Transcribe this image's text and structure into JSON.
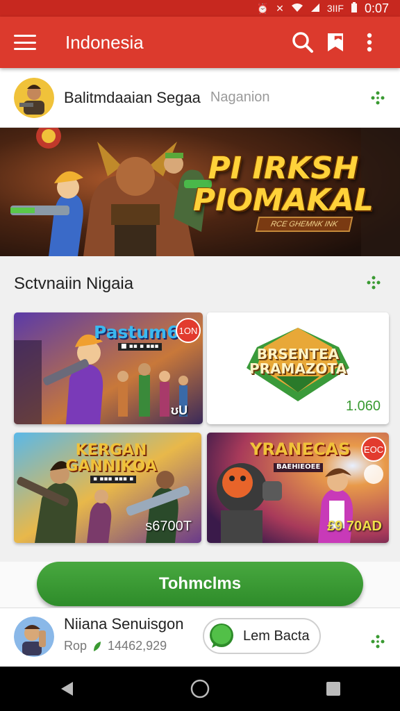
{
  "status_bar": {
    "time": "0:07",
    "icons": [
      "alarm-icon",
      "mute-icon",
      "wifi-icon",
      "signal-icon",
      "battery-icon"
    ],
    "carrier_text": "3IIF"
  },
  "app_bar": {
    "title": "Indonesia",
    "actions": [
      "search-icon",
      "bookmark-icon",
      "more-vert-icon"
    ]
  },
  "profile": {
    "name": "Balitmdaaian Segaa",
    "subtitle": "Naganion"
  },
  "hero_banner": {
    "title_line1": "PI IRKSH",
    "title_line2": "PIOMAKAL",
    "ribbon": "RCE GHEMNK INK"
  },
  "section": {
    "title": "Sctvnaiin Nigaia",
    "cards": [
      {
        "title": "Pastum6",
        "subtitle": "■ ▪▪ ▪ ▪▪▪",
        "badge": "1ON",
        "tag": "ʊU"
      },
      {
        "title_line1": "BRSENTEA",
        "title_line2": "PRAMAZOTA",
        "value": "1.060"
      },
      {
        "title_line1": "KERGAN",
        "title_line2": "GANNIKOA",
        "subtitle": "▪ ▪▪▪ ▪▪▪ ▪",
        "value": "s6700T"
      },
      {
        "title": "YRANECAS",
        "subtitle": "BAEHIEOEE",
        "badge": "EOC",
        "value": "£9 70AD"
      }
    ]
  },
  "cta": {
    "label": "Tohmclms"
  },
  "bottom_item": {
    "name": "Niiana Senuisgon",
    "meta_label": "Rop",
    "meta_value": "14462,929",
    "button_label": "Lem Bacta"
  },
  "nav_bar": {
    "buttons": [
      "back-icon",
      "home-icon",
      "recents-icon"
    ]
  },
  "colors": {
    "app_bar": "#dc3a2d",
    "status_bar": "#c7281f",
    "cta": "#3a9a32",
    "accent_green": "#3a9a32"
  }
}
